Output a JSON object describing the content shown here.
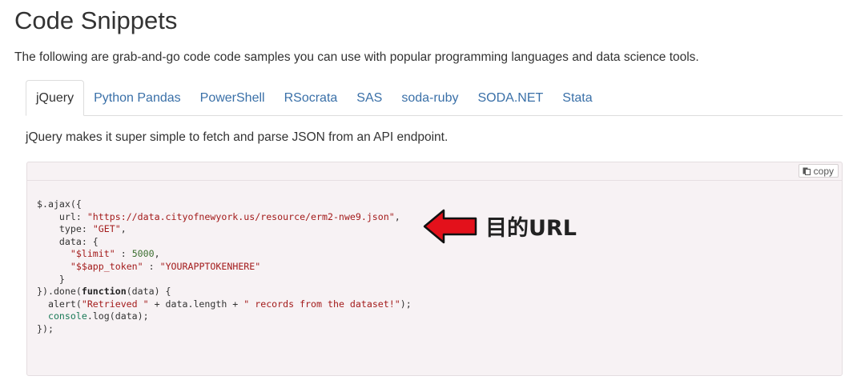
{
  "page": {
    "title": "Code Snippets",
    "intro": "The following are grab-and-go code code samples you can use with popular programming languages and data science tools."
  },
  "tabs": [
    {
      "label": "jQuery",
      "active": true
    },
    {
      "label": "Python Pandas",
      "active": false
    },
    {
      "label": "PowerShell",
      "active": false
    },
    {
      "label": "RSocrata",
      "active": false
    },
    {
      "label": "SAS",
      "active": false
    },
    {
      "label": "soda-ruby",
      "active": false
    },
    {
      "label": "SODA.NET",
      "active": false
    },
    {
      "label": "Stata",
      "active": false
    }
  ],
  "snippet": {
    "description": "jQuery makes it super simple to fetch and parse JSON from an API endpoint.",
    "copy_label": "copy",
    "copy_icon": "clipboard-icon",
    "code": {
      "line1": "$.ajax({",
      "url_key": "    url: ",
      "url_value": "\"https://data.cityofnewyork.us/resource/erm2-nwe9.json\"",
      "url_tail": ",",
      "type_key": "    type: ",
      "type_value": "\"GET\"",
      "type_tail": ",",
      "data_open": "    data: {",
      "limit_indent": "      ",
      "limit_key": "\"$limit\"",
      "limit_sep": " : ",
      "limit_value": "5000",
      "limit_tail": ",",
      "token_indent": "      ",
      "token_key": "\"$$app_token\"",
      "token_sep": " : ",
      "token_value": "\"YOURAPPTOKENHERE\"",
      "data_close": "    }",
      "done_open": "}).done(",
      "done_keyword": "function",
      "done_params": "(data) {",
      "alert_start": "  alert(",
      "alert_str1": "\"Retrieved \"",
      "alert_mid": " + data.length + ",
      "alert_str2": "\" records from the dataset!\"",
      "alert_end": ");",
      "console_indent": "  ",
      "console_obj": "console",
      "console_call": ".log(data);",
      "close": "});"
    }
  },
  "annotation": {
    "label": "目的URL",
    "arrow_color": "#e3111b",
    "arrow_outline": "#111111"
  }
}
